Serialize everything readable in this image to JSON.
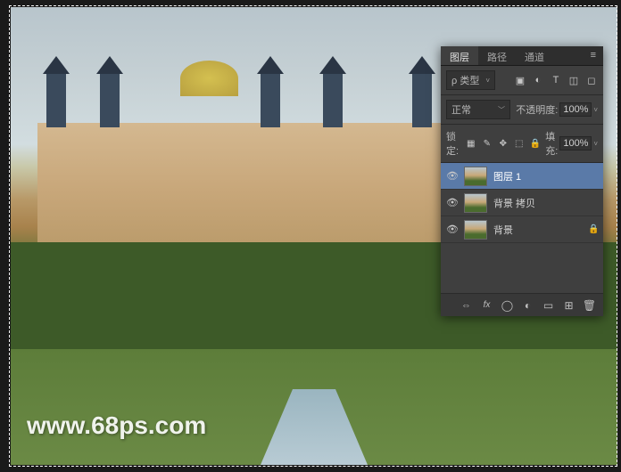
{
  "watermark": "www.68ps.com",
  "panel": {
    "tabs": {
      "layers": "图层",
      "channels": "路径",
      "paths": "通道"
    },
    "menu_glyph": "≡",
    "type": {
      "label": "ρ 类型",
      "img": "▣",
      "adj": "◐",
      "txt": "T",
      "shape": "◫",
      "smart": "◻"
    },
    "blend": {
      "mode": "正常",
      "opacity_label": "不透明度:",
      "opacity_value": "100%"
    },
    "lock": {
      "label": "锁定:",
      "img": "▦",
      "pos": "✎",
      "move": "✥",
      "art": "⬚",
      "all": "🔒",
      "fill_label": "填充:",
      "fill_value": "100%"
    },
    "layers": [
      {
        "name": "图层 1",
        "selected": true,
        "locked": false
      },
      {
        "name": "背景 拷贝",
        "selected": false,
        "locked": false
      },
      {
        "name": "背景",
        "selected": false,
        "locked": true
      }
    ],
    "footer": {
      "link": "⇔",
      "fx": "fx",
      "mask": "◯",
      "adj": "◐",
      "group": "▭",
      "new": "⊞",
      "trash": "🗑"
    }
  },
  "icons": {
    "eye": "👁",
    "chev": "﹀",
    "chev_sm": "˅",
    "lock": "🔒"
  }
}
